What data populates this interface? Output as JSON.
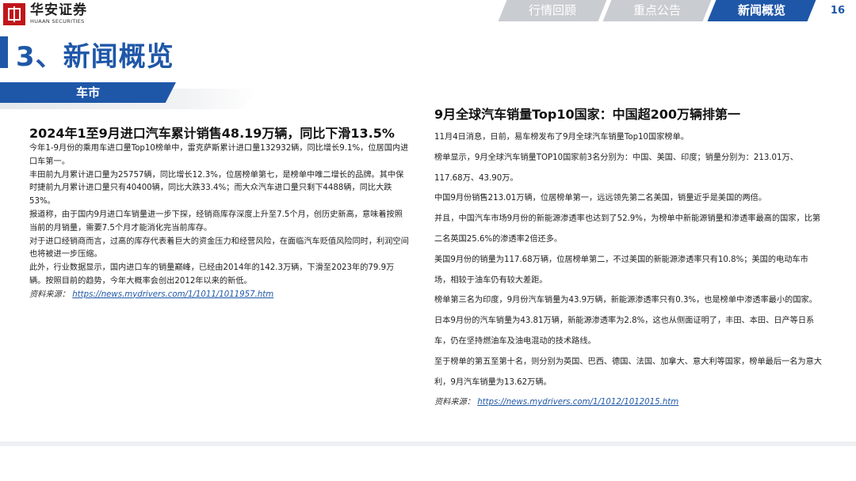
{
  "brand": {
    "name_cn": "华安证券",
    "name_en": "HUAAN SECURITIES"
  },
  "nav": {
    "tabs": [
      {
        "label": "行情回顾",
        "active": false
      },
      {
        "label": "重点公告",
        "active": false
      },
      {
        "label": "新闻概览",
        "active": true
      }
    ]
  },
  "page_number": "16",
  "page_title": "3、新闻概览",
  "section_tag": "车市",
  "colors": {
    "brand_blue": "#1f57a8",
    "brand_red": "#c0161b",
    "inactive_tab": "#c9ccd1"
  },
  "left_article": {
    "headline": "2024年1至9月进口汽车累计销售48.19万辆，同比下滑13.5%",
    "paragraphs": [
      "今年1-9月份的乘用车进口量Top10榜单中，雷克萨斯累计进口量132932辆，同比增长9.1%，位居国内进口车第一。",
      "丰田前九月累计进口量为25757辆，同比增长12.3%，位居榜单第七，是榜单中唯二增长的品牌。其中保时捷前九月累计进口量只有40400辆，同比大跌33.4%；而大众汽车进口量只剩下4488辆，同比大跌53%。",
      "报道称，由于国内9月进口车销量进一步下探，经销商库存深度上升至7.5个月，创历史新高，意味着按照当前的月销量，需要7.5个月才能消化完当前库存。",
      "对于进口经销商而言，过高的库存代表着巨大的资金压力和经营风险，在面临汽车贬值风险同时，利润空间也将被进一步压缩。",
      "此外，行业数据显示，国内进口车的销量巅峰，已经由2014年的142.3万辆，下滑至2023年的79.9万辆。按照目前的趋势，今年大概率会创出2012年以来的新低。"
    ],
    "source_label": "资料来源：",
    "source_url": "https://news.mydrivers.com/1/1011/1011957.htm"
  },
  "right_article": {
    "headline": "9月全球汽车销量Top10国家：中国超200万辆排第一",
    "paragraphs": [
      "11月4日消息，日前，易车榜发布了9月全球汽车销量Top10国家榜单。",
      "榜单显示，9月全球汽车销量TOP10国家前3名分别为：中国、美国、印度；销量分别为：213.01万、117.68万、43.90万。",
      "中国9月份销售213.01万辆，位居榜单第一，远远领先第二名美国，销量近乎是美国的两倍。",
      "并且，中国汽车市场9月份的新能源渗透率也达到了52.9%，为榜单中新能源销量和渗透率最高的国家，比第二名英国25.6%的渗透率2倍还多。",
      "美国9月份的销量为117.68万辆，位居榜单第二，不过美国的新能源渗透率只有10.8%；美国的电动车市场，相较于油车仍有较大差距。",
      "榜单第三名为印度，9月份汽车销量为43.9万辆，新能源渗透率只有0.3%，也是榜单中渗透率最小的国家。",
      "日本9月份的汽车销量为43.81万辆，新能源渗透率为2.8%，这也从侧面证明了，丰田、本田、日产等日系车，仍在坚持燃油车及油电混动的技术路线。",
      "至于榜单的第五至第十名，则分别为英国、巴西、德国、法国、加拿大、意大利等国家，榜单最后一名为意大利，9月汽车销量为13.62万辆。"
    ],
    "source_label": "资料来源：",
    "source_url": "https://news.mydrivers.com/1/1012/1012015.htm"
  }
}
